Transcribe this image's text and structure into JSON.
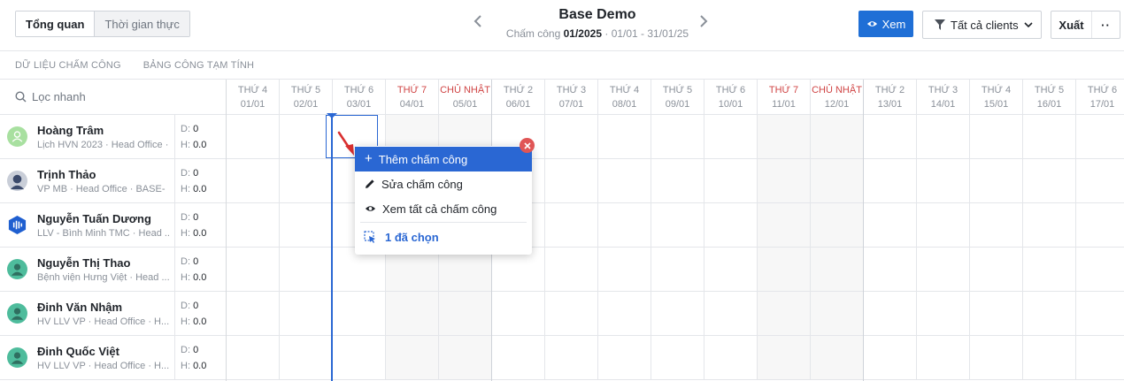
{
  "view_tabs": {
    "overview": "Tổng quan",
    "realtime": "Thời gian thực"
  },
  "header": {
    "title": "Base Demo",
    "period_label": "Chấm công",
    "period_month": "01/2025",
    "period_range": "· 01/01 - 31/01/25"
  },
  "toolbar": {
    "view_label": "Xem",
    "filter_label": "Tất cả clients",
    "export_label": "Xuất",
    "more_label": "··"
  },
  "subtabs": [
    "DỮ LIỆU CHẤM CÔNG",
    "BẢNG CÔNG TẠM TÍNH"
  ],
  "search": {
    "placeholder": "Lọc nhanh"
  },
  "stat_labels": {
    "d": "D:",
    "h": "H:"
  },
  "employees": [
    {
      "name": "Hoàng Trâm",
      "sub": "Lịch HVN 2023 · Head Office ·",
      "d": "0",
      "h": "0.0",
      "avatar": "user-outline",
      "color": "#a8e0a0"
    },
    {
      "name": "Trịnh Thảo",
      "sub": "VP MB · Head Office · BASE-",
      "d": "0",
      "h": "0.0",
      "avatar": "photo",
      "color": "#3b4a6b"
    },
    {
      "name": "Nguyễn Tuấn Dương",
      "sub": "LLV - Bình Minh TMC · Head ...",
      "d": "0",
      "h": "0.0",
      "avatar": "hexagon-logo",
      "color": "#1f5fd0"
    },
    {
      "name": "Nguyễn Thị Thao",
      "sub": "Bệnh viện Hưng Việt · Head ...",
      "d": "0",
      "h": "0.0",
      "avatar": "user",
      "color": "#4ebc9c"
    },
    {
      "name": "Đinh Văn Nhậm",
      "sub": "HV LLV VP · Head Office · H...",
      "d": "0",
      "h": "0.0",
      "avatar": "user",
      "color": "#4ebc9c"
    },
    {
      "name": "Đinh Quốc Việt",
      "sub": "HV LLV VP · Head Office · H...",
      "d": "0",
      "h": "0.0",
      "avatar": "user",
      "color": "#4ebc9c"
    }
  ],
  "days": [
    {
      "dow": "THỨ 4",
      "date": "01/01",
      "weekend": false
    },
    {
      "dow": "THỨ 5",
      "date": "02/01",
      "weekend": false
    },
    {
      "dow": "THỨ 6",
      "date": "03/01",
      "weekend": false
    },
    {
      "dow": "THỨ 7",
      "date": "04/01",
      "weekend": true
    },
    {
      "dow": "CHỦ NHẬT",
      "date": "05/01",
      "weekend": true
    },
    {
      "dow": "THỨ 2",
      "date": "06/01",
      "weekend": false
    },
    {
      "dow": "THỨ 3",
      "date": "07/01",
      "weekend": false
    },
    {
      "dow": "THỨ 4",
      "date": "08/01",
      "weekend": false
    },
    {
      "dow": "THỨ 5",
      "date": "09/01",
      "weekend": false
    },
    {
      "dow": "THỨ 6",
      "date": "10/01",
      "weekend": false
    },
    {
      "dow": "THỨ 7",
      "date": "11/01",
      "weekend": true
    },
    {
      "dow": "CHỦ NHẬT",
      "date": "12/01",
      "weekend": true
    },
    {
      "dow": "THỨ 2",
      "date": "13/01",
      "weekend": false
    },
    {
      "dow": "THỨ 3",
      "date": "14/01",
      "weekend": false
    },
    {
      "dow": "THỨ 4",
      "date": "15/01",
      "weekend": false
    },
    {
      "dow": "THỨ 5",
      "date": "16/01",
      "weekend": false
    },
    {
      "dow": "THỨ 6",
      "date": "17/01",
      "weekend": false
    }
  ],
  "context_menu": {
    "add": "Thêm chấm công",
    "edit": "Sửa chấm công",
    "view_all": "Xem tất cả chấm công",
    "selected": "1 đã chọn"
  },
  "colors": {
    "accent": "#1f6fd6",
    "weekend_text": "#d04545",
    "close": "#e05555"
  }
}
